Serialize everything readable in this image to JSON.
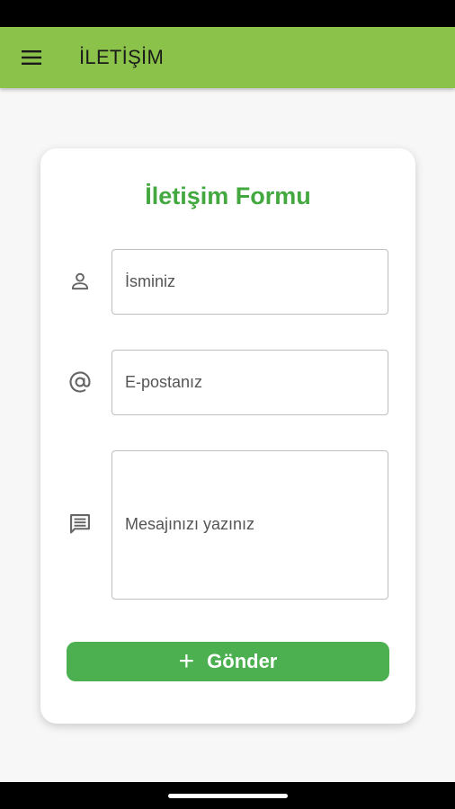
{
  "app_bar": {
    "menu_icon": "menu-icon",
    "title": "İLETİŞİM",
    "color": "#8bc34a"
  },
  "form": {
    "title": "İletişim Formu",
    "title_color": "#43a83f",
    "name_field": {
      "icon": "person-icon",
      "placeholder": "İsminiz",
      "value": ""
    },
    "email_field": {
      "icon": "at-icon",
      "placeholder": "E-postanız",
      "value": ""
    },
    "message_field": {
      "icon": "message-icon",
      "placeholder": "Mesajınızı yazınız",
      "value": ""
    },
    "submit": {
      "icon": "plus-icon",
      "label": "Gönder",
      "color": "#4caf50"
    }
  }
}
